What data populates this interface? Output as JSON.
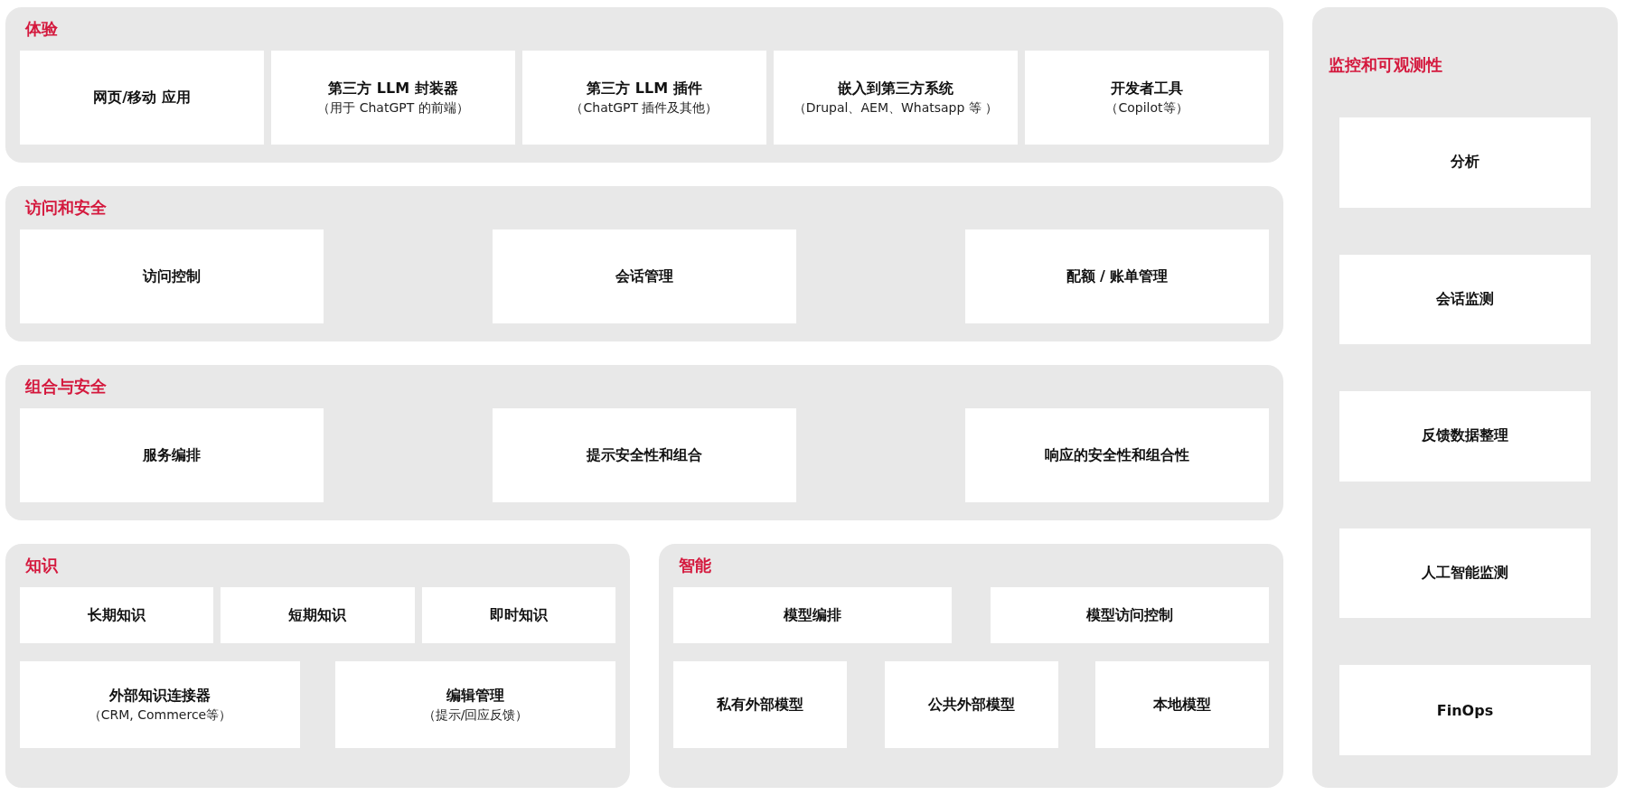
{
  "sections": [
    {
      "title": "体验",
      "rows": [
        {
          "kind": "fill",
          "cards": [
            {
              "title": "网页/移动 应用"
            },
            {
              "title": "第三方 LLM 封装器",
              "subtitle": "（用于 ChatGPT 的前端）"
            },
            {
              "title": "第三方 LLM 插件",
              "subtitle": "（ChatGPT 插件及其他）"
            },
            {
              "title": "嵌入到第三方系统",
              "subtitle": "（Drupal、AEM、Whatsapp 等 ）"
            },
            {
              "title": "开发者工具",
              "subtitle": "（Copilot等）"
            }
          ]
        }
      ]
    },
    {
      "title": "访问和安全",
      "rows": [
        {
          "kind": "spread",
          "cards": [
            {
              "title": "访问控制"
            },
            {
              "title": "会话管理"
            },
            {
              "title": "配额 / 账单管理"
            }
          ]
        }
      ]
    },
    {
      "title": "组合与安全",
      "rows": [
        {
          "kind": "spread",
          "cards": [
            {
              "title": "服务编排"
            },
            {
              "title": "提示安全性和组合"
            },
            {
              "title": "响应的安全性和组合性"
            }
          ]
        }
      ]
    }
  ],
  "bottom_sections": [
    {
      "title": "知识",
      "rows": [
        {
          "kind": "fill",
          "cards": [
            {
              "title": "长期知识"
            },
            {
              "title": "短期知识"
            },
            {
              "title": "即时知识"
            }
          ]
        },
        {
          "kind": "spread",
          "cards": [
            {
              "title": "外部知识连接器",
              "subtitle": "（CRM, Commerce等）"
            },
            {
              "title": "编辑管理",
              "subtitle": "（提示/回应反馈）"
            }
          ]
        }
      ]
    },
    {
      "title": "智能",
      "rows": [
        {
          "kind": "spread",
          "cards": [
            {
              "title": "模型编排"
            },
            {
              "title": "模型访问控制"
            }
          ]
        },
        {
          "kind": "spread",
          "cards": [
            {
              "title": "私有外部模型"
            },
            {
              "title": "公共外部模型"
            },
            {
              "title": "本地模型"
            }
          ]
        }
      ]
    }
  ],
  "side": {
    "title": "监控和可观测性",
    "cards": [
      {
        "title": "分析"
      },
      {
        "title": "会话监测"
      },
      {
        "title": "反馈数据整理"
      },
      {
        "title": "人工智能监测"
      },
      {
        "title": "FinOps"
      }
    ]
  }
}
